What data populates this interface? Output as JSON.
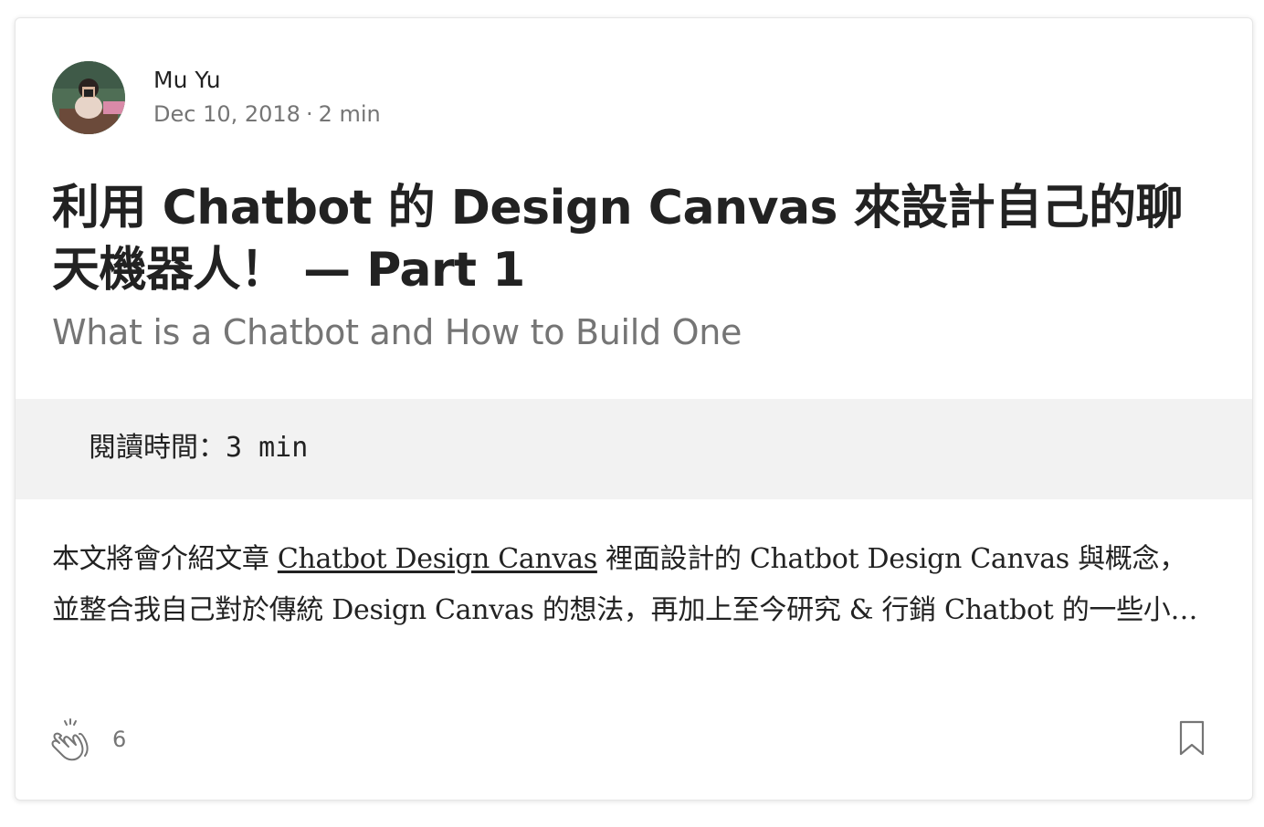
{
  "author": {
    "name": "Mu Yu",
    "date": "Dec 10, 2018",
    "separator": "·",
    "read_time": "2 min",
    "avatar_icon": "avatar-photo"
  },
  "post": {
    "title": "利用 Chatbot 的 Design Canvas 來設計自己的聊天機器人！ — Part 1",
    "subtitle": "What is a Chatbot and How to Build One",
    "reading_time_label": "閱讀時間：3 min",
    "excerpt_before": "本文將會介紹文章 ",
    "excerpt_link": "Chatbot Design Canvas",
    "excerpt_after": " 裡面設計的 Chatbot Design Canvas 與概念，並整合我自己對於傳統 Design Canvas 的想法，再加上至今研究 & 行銷 Chatbot 的一些小…"
  },
  "footer": {
    "clap_icon": "clap-icon",
    "clap_count": "6",
    "bookmark_icon": "bookmark-icon"
  },
  "colors": {
    "text_primary": "#222222",
    "text_secondary": "#757575",
    "block_background": "#f2f2f2",
    "card_border": "#e6e6e6"
  }
}
